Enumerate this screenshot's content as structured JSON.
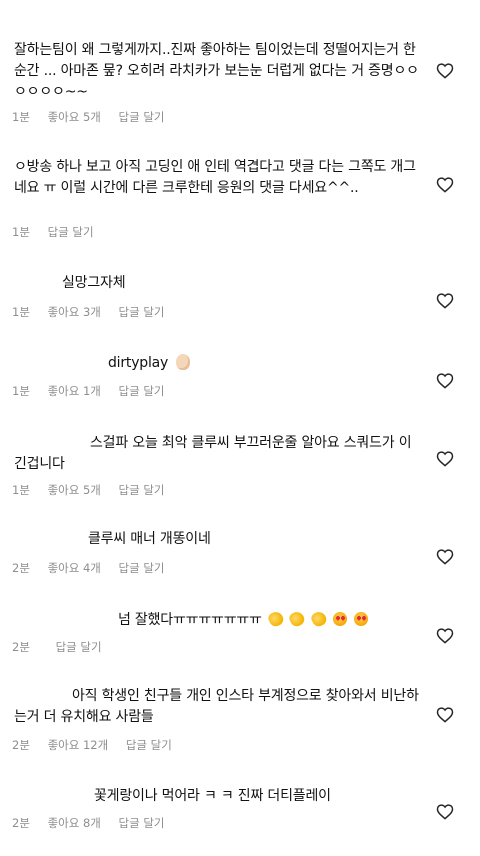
{
  "comments": [
    {
      "username": "",
      "text": "잘하는팀이 왜 그렇게까지..진짜 좋아하는 팀이었는데 정떨어지는거 한순간 ... 아마존 뭎? 오히려 라치카가 보는눈 더럽게 없다는 거 증명ㅇㅇㅇㅇㅇㅇ~~",
      "time": "1분",
      "likes": "좋아요 5개",
      "reply": "답글 달기"
    },
    {
      "username": "",
      "text": "ㅇ방송 하나 보고 아직 고딩인 애 인테 역겹다고 댓글 다는 그쪽도 개그네요 ㅠ 이럴 시간에 다른 크루한테 응원의 댓글 다세요^^..",
      "time": "1분",
      "likes": "",
      "reply": "답글 달기"
    },
    {
      "username": "",
      "text": "실망그자체",
      "time": "1분",
      "likes": "좋아요 3개",
      "reply": "답글 달기"
    },
    {
      "username": "",
      "text": "dirtyplay",
      "time": "1분",
      "likes": "좋아요 1개",
      "reply": "답글 달기"
    },
    {
      "username": "",
      "text": "스걸파 오늘 최악 클루씨 부끄러운줄 알아요 스쿼드가 이긴겁니다",
      "time": "1분",
      "likes": "좋아요 5개",
      "reply": "답글 달기"
    },
    {
      "username": "",
      "text": "클루씨 매너 개똥이네",
      "time": "2분",
      "likes": "좋아요 4개",
      "reply": "답글 달기"
    },
    {
      "username": "",
      "text": "넘 잘했다ㅠㅠㅠㅠㅠㅠㅠ",
      "time": "2분",
      "likes": "",
      "reply": "답글 달기"
    },
    {
      "username": "",
      "text": "아직 학생인 친구들 개인 인스타 부계정으로 찾아와서 비난하는거 더 유치해요 사람들",
      "time": "2분",
      "likes": "좋아요 12개",
      "reply": "답글 달기"
    },
    {
      "username": "",
      "text": "꽃게랑이나 먹어라 ㅋ ㅋ 진짜 더티플레이",
      "time": "2분",
      "likes": "좋아요 8개",
      "reply": "답글 달기"
    }
  ],
  "icons": {
    "like": "heart-outline-icon",
    "emoji_ok": "ok-hand-emoji",
    "emoji_clap": "clapping-hands-emoji",
    "emoji_hearteyes": "heart-eyes-emoji"
  }
}
